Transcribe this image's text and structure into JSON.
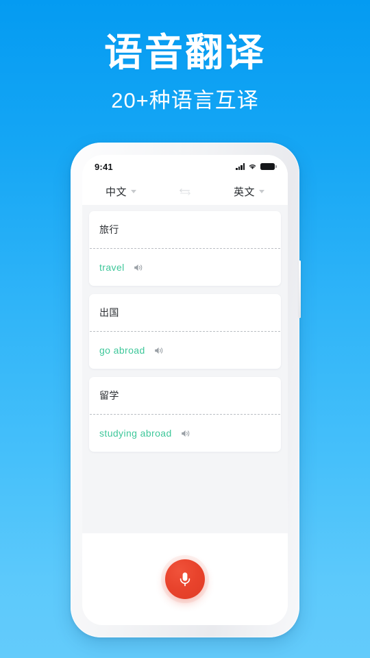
{
  "hero": {
    "title": "语音翻译",
    "subtitle": "20+种语言互译"
  },
  "phone": {
    "statusbar": {
      "time": "9:41",
      "signal_icon": "signal-bars-icon",
      "wifi_icon": "wifi-icon",
      "battery_icon": "battery-icon"
    },
    "langbar": {
      "source_language": "中文",
      "target_language": "英文",
      "swap_icon": "swap-arrows-icon",
      "source_caret_icon": "chevron-down-icon",
      "target_caret_icon": "chevron-down-icon"
    },
    "cards": [
      {
        "source": "旅行",
        "target": "travel",
        "speaker_icon": "speaker-icon"
      },
      {
        "source": "出国",
        "target": "go abroad",
        "speaker_icon": "speaker-icon"
      },
      {
        "source": "留学",
        "target": "studying abroad",
        "speaker_icon": "speaker-icon"
      }
    ],
    "mic": {
      "icon": "microphone-icon",
      "label": ""
    }
  },
  "colors": {
    "background_top": "#049bf2",
    "background_bottom": "#63cbfb",
    "translation_green": "#3ec79a",
    "mic_red": "#e8432c",
    "content_gray": "#f4f5f7"
  }
}
